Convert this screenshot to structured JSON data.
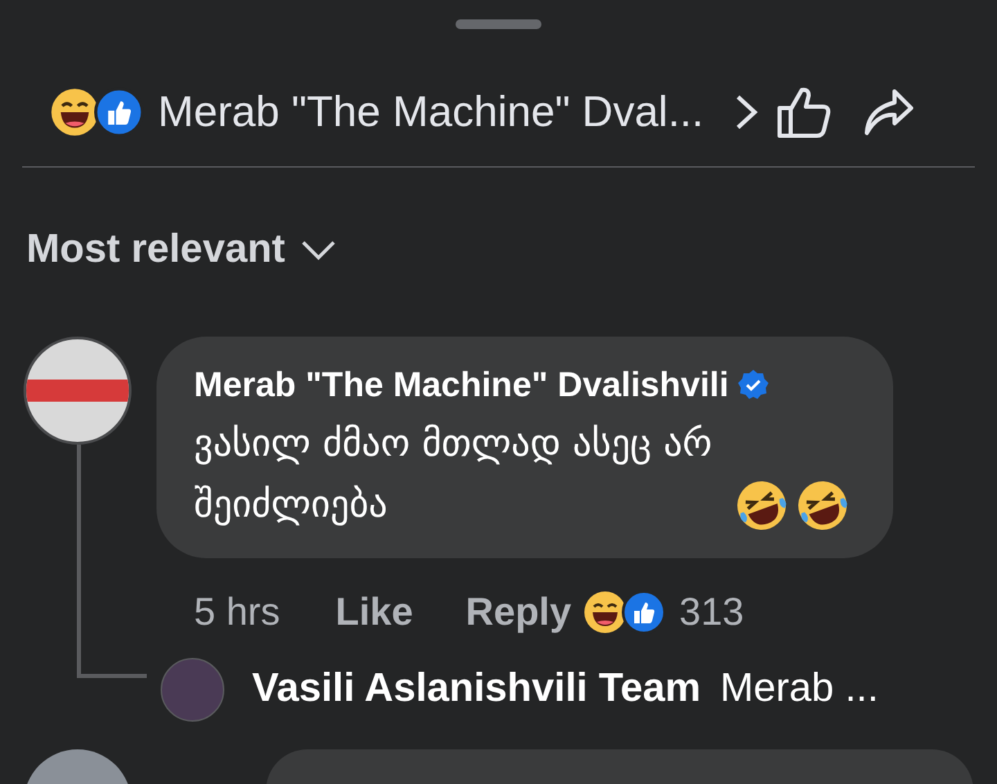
{
  "header": {
    "title": "Merab \"The Machine\" Dval..."
  },
  "sort": {
    "label": "Most relevant"
  },
  "comment": {
    "author": "Merab \"The Machine\" Dvalishvili",
    "verified": true,
    "text": "ვასილ ძმაო მთლად ასეც არ შეიძლიება",
    "time": "5 hrs",
    "like_label": "Like",
    "reply_label": "Reply",
    "reaction_count": "313"
  },
  "reply": {
    "author": "Vasili Aslanishvili Team",
    "preview": "Merab ..."
  }
}
